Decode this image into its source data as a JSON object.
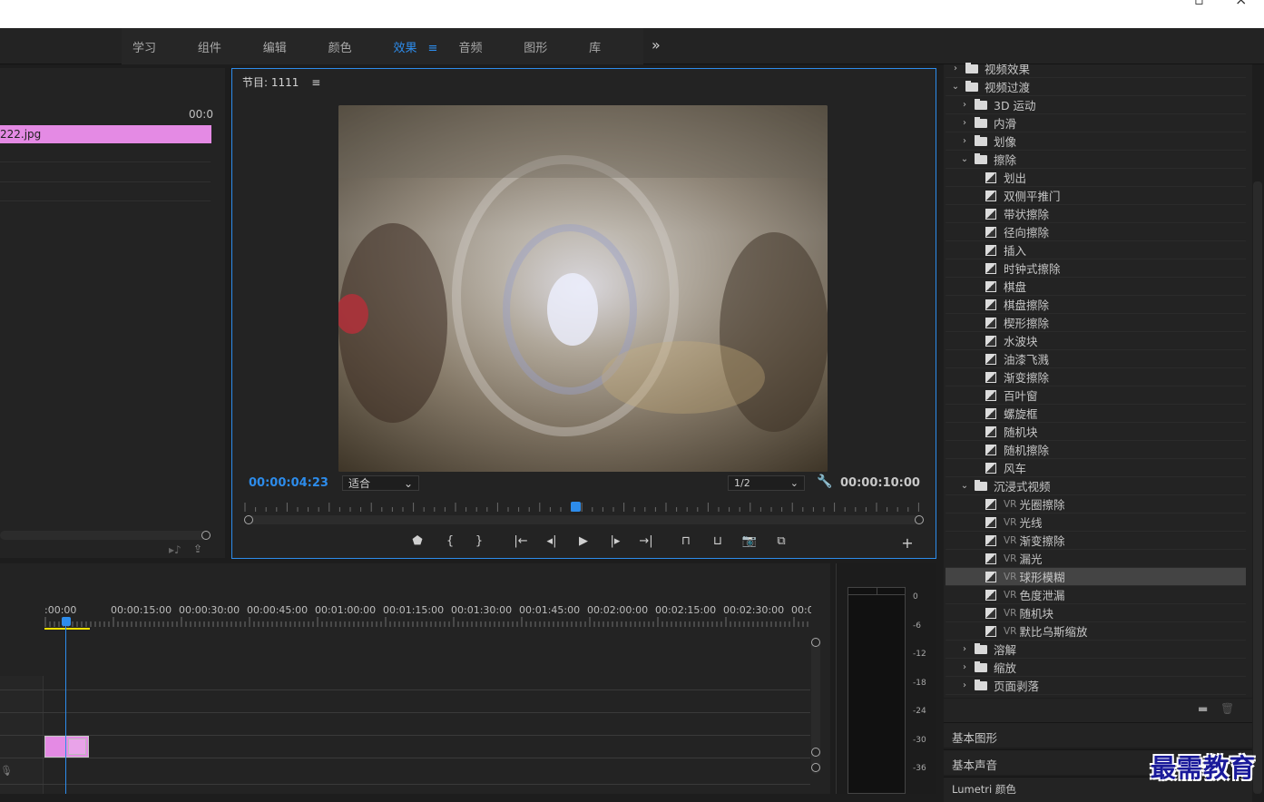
{
  "workspace_tabs": [
    "学习",
    "组件",
    "编辑",
    "颜色",
    "效果",
    "音频",
    "图形",
    "库"
  ],
  "active_tab": "效果",
  "more_icon": "»",
  "source": {
    "timecode": "00:0",
    "clip_label": "222.jpg"
  },
  "program": {
    "title": "节目: 1111",
    "menu_icon": "≡",
    "current_time": "00:00:04:23",
    "fit": "适合",
    "resolution": "1/2",
    "duration": "00:00:10:00"
  },
  "timeline": {
    "ruler": [
      ":00:00",
      "00:00:15:00",
      "00:00:30:00",
      "00:00:45:00",
      "00:01:00:00",
      "00:01:15:00",
      "00:01:30:00",
      "00:01:45:00",
      "00:02:00:00",
      "00:02:15:00",
      "00:02:30:00",
      "00:02:45:0"
    ]
  },
  "meters": [
    "0",
    "-6",
    "-12",
    "-18",
    "-24",
    "-30",
    "-36"
  ],
  "effects": {
    "rows": [
      {
        "level": 0,
        "kind": "folder",
        "open": false,
        "label": "视频效果"
      },
      {
        "level": 0,
        "kind": "folder",
        "open": true,
        "label": "视频过渡"
      },
      {
        "level": 1,
        "kind": "folder",
        "open": false,
        "label": "3D 运动"
      },
      {
        "level": 1,
        "kind": "folder",
        "open": false,
        "label": "内滑"
      },
      {
        "level": 1,
        "kind": "folder",
        "open": false,
        "label": "划像"
      },
      {
        "level": 1,
        "kind": "folder",
        "open": true,
        "label": "擦除"
      },
      {
        "level": 2,
        "kind": "fx",
        "label": "划出"
      },
      {
        "level": 2,
        "kind": "fx",
        "label": "双侧平推门"
      },
      {
        "level": 2,
        "kind": "fx",
        "label": "带状擦除"
      },
      {
        "level": 2,
        "kind": "fx",
        "label": "径向擦除"
      },
      {
        "level": 2,
        "kind": "fx",
        "label": "插入"
      },
      {
        "level": 2,
        "kind": "fx",
        "label": "时钟式擦除"
      },
      {
        "level": 2,
        "kind": "fx",
        "label": "棋盘"
      },
      {
        "level": 2,
        "kind": "fx",
        "label": "棋盘擦除"
      },
      {
        "level": 2,
        "kind": "fx",
        "label": "楔形擦除"
      },
      {
        "level": 2,
        "kind": "fx",
        "label": "水波块"
      },
      {
        "level": 2,
        "kind": "fx",
        "label": "油漆飞溅"
      },
      {
        "level": 2,
        "kind": "fx",
        "label": "渐变擦除"
      },
      {
        "level": 2,
        "kind": "fx",
        "label": "百叶窗"
      },
      {
        "level": 2,
        "kind": "fx",
        "label": "螺旋框"
      },
      {
        "level": 2,
        "kind": "fx",
        "label": "随机块"
      },
      {
        "level": 2,
        "kind": "fx",
        "label": "随机擦除"
      },
      {
        "level": 2,
        "kind": "fx",
        "label": "风车"
      },
      {
        "level": 1,
        "kind": "folder",
        "open": true,
        "label": "沉浸式视频"
      },
      {
        "level": 2,
        "kind": "fx",
        "vr": true,
        "label": "光圈擦除"
      },
      {
        "level": 2,
        "kind": "fx",
        "vr": true,
        "label": "光线"
      },
      {
        "level": 2,
        "kind": "fx",
        "vr": true,
        "label": "渐变擦除"
      },
      {
        "level": 2,
        "kind": "fx",
        "vr": true,
        "label": "漏光"
      },
      {
        "level": 2,
        "kind": "fx",
        "vr": true,
        "selected": true,
        "label": "球形模糊"
      },
      {
        "level": 2,
        "kind": "fx",
        "vr": true,
        "label": "色度泄漏"
      },
      {
        "level": 2,
        "kind": "fx",
        "vr": true,
        "label": "随机块"
      },
      {
        "level": 2,
        "kind": "fx",
        "vr": true,
        "label": "默比乌斯缩放"
      },
      {
        "level": 1,
        "kind": "folder",
        "open": false,
        "label": "溶解"
      },
      {
        "level": 1,
        "kind": "folder",
        "open": false,
        "label": "缩放"
      },
      {
        "level": 1,
        "kind": "folder",
        "open": false,
        "label": "页面剥落"
      }
    ]
  },
  "vr_prefix": "VR",
  "sections": [
    "基本图形",
    "基本声音",
    "Lumetri 颜色"
  ],
  "watermark": "最需教育",
  "colors": {
    "accent": "#2d8ceb",
    "clip": "#e48ae4",
    "selected_row": "#444444"
  }
}
